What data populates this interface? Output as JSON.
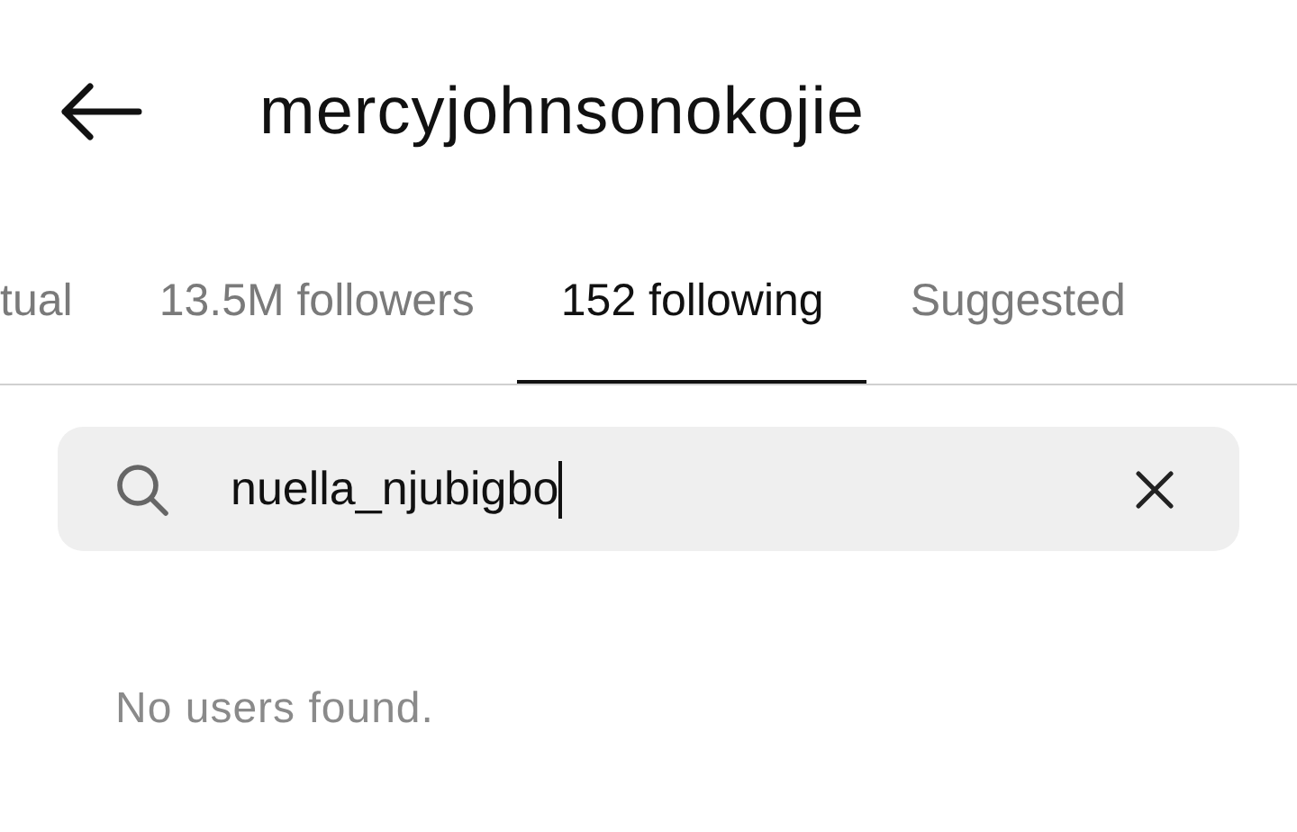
{
  "header": {
    "title": "mercyjohnsonokojie"
  },
  "tabs": [
    {
      "label": "tual",
      "selected": false
    },
    {
      "label": "13.5M followers",
      "selected": false
    },
    {
      "label": "152 following",
      "selected": true
    },
    {
      "label": "Suggested",
      "selected": false
    }
  ],
  "search": {
    "value": "nuella_njubigbo"
  },
  "empty_message": "No users found."
}
